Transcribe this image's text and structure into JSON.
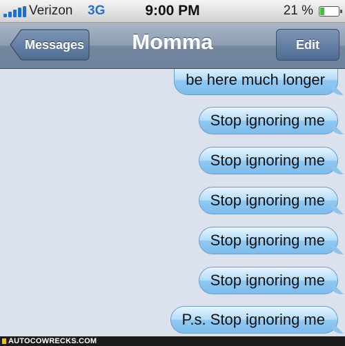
{
  "status": {
    "carrier": "Verizon",
    "network": "3G",
    "time": "9:00 PM",
    "battery": "21 %",
    "battery_level": 0.21
  },
  "nav": {
    "back_label": "Messages",
    "title": "Momma",
    "edit_label": "Edit"
  },
  "messages": [
    "be here much longer",
    "Stop ignoring me",
    "Stop ignoring me",
    "Stop ignoring me",
    "Stop ignoring me",
    "Stop ignoring me",
    "P.s. Stop ignoring me"
  ],
  "watermark": "AUTOCOWRECKS.COM",
  "colors": {
    "network": "#2a6fcc",
    "bubble": "#b4dcf9",
    "background": "#dbe2ed"
  }
}
